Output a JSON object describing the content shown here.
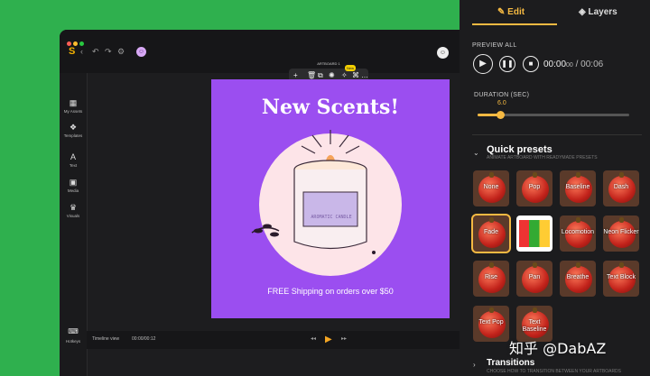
{
  "editor": {
    "toolbar": {
      "label": "ARTBOARD 1",
      "ai_badge": "New"
    },
    "sidebar": [
      {
        "label": "My Assets",
        "icon": "assets-icon"
      },
      {
        "label": "Templates",
        "icon": "templates-icon"
      },
      {
        "label": "Text",
        "icon": "text-icon"
      },
      {
        "label": "Media",
        "icon": "media-icon"
      },
      {
        "label": "Visuals",
        "icon": "visuals-icon"
      }
    ],
    "hotkeys_label": "Hotkeys",
    "artboard": {
      "headline": "New Scents!",
      "jar_label": "AROMATIC CANDLE",
      "shipping": "FREE Shipping on orders over $50",
      "bg_color": "#9b4ef0"
    },
    "timeline": {
      "label": "Timeline view",
      "time": "00:00/00:12"
    }
  },
  "panel": {
    "tabs": [
      {
        "label": "Edit",
        "active": true
      },
      {
        "label": "Layers",
        "active": false
      }
    ],
    "preview_label": "PREVIEW ALL",
    "time_main": "00:00",
    "time_frac": "00",
    "time_total": "/ 00:06",
    "duration_label": "DURATION (SEC)",
    "duration_value": "6.0",
    "duration_fraction": 0.15,
    "quick_presets": {
      "title": "Quick presets",
      "subtitle": "ANIMATE ARTBOARD WITH READYMADE PRESETS",
      "items": [
        "None",
        "Pop",
        "Baseline",
        "Dash",
        "Fade",
        "",
        "Locomotion",
        "Neon Flicker",
        "Rise",
        "Pan",
        "Breathe",
        "Text Block",
        "Text Pop",
        "Text Baseline"
      ]
    },
    "transitions": {
      "title": "Transitions",
      "subtitle": "CHOOSE HOW TO TRANSITION BETWEEN YOUR ARTBOARDS"
    },
    "accent": "#f5b942"
  },
  "watermark": "知乎 @DabAZ"
}
